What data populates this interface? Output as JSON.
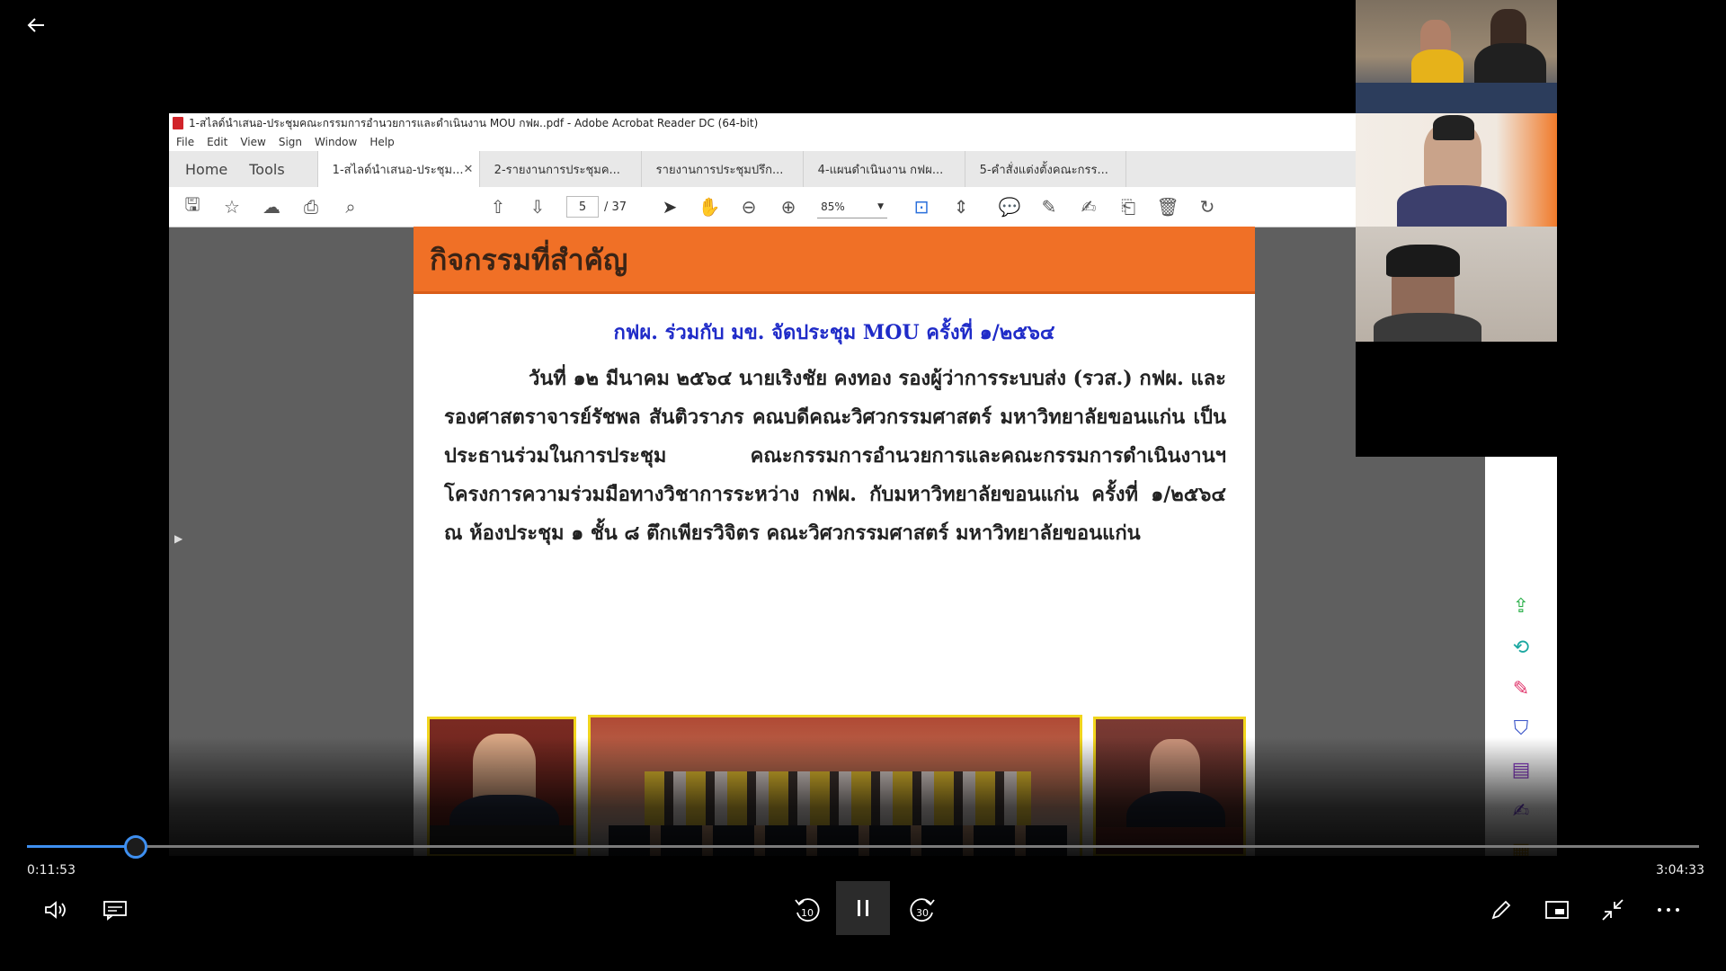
{
  "player": {
    "current_time": "0:11:53",
    "total_time": "3:04:33",
    "progress_fraction": 0.065,
    "icons": {
      "back": "back-arrow-icon",
      "volume": "volume-icon",
      "captions": "captions-icon",
      "rewind": "rewind-10-icon",
      "pause": "pause-icon",
      "forward": "forward-30-icon",
      "pen": "pen-icon",
      "miniplayer": "miniplayer-icon",
      "exit_fullscreen": "exit-fullscreen-icon",
      "more": "more-icon"
    },
    "rewind_label": "10",
    "forward_label": "30"
  },
  "acrobat": {
    "title": "1-สไลด์นำเสนอ-ประชุมคณะกรรมการอำนวยการและดำเนินงาน MOU กฟผ..pdf - Adobe Acrobat Reader DC (64-bit)",
    "menu": [
      "File",
      "Edit",
      "View",
      "Sign",
      "Window",
      "Help"
    ],
    "home_tab": "Home",
    "tools_tab": "Tools",
    "doc_tabs": [
      {
        "label": "1-สไลด์นำเสนอ-ประชุม...",
        "active": true
      },
      {
        "label": "2-รายงานการประชุมค...",
        "active": false
      },
      {
        "label": "รายงานการประชุมปรึก...",
        "active": false
      },
      {
        "label": "4-แผนดำเนินงาน กฟผ...",
        "active": false
      },
      {
        "label": "5-คำสั่งแต่งตั้งคณะกรร...",
        "active": false
      }
    ],
    "page_current": "5",
    "page_total": "/ 37",
    "zoom": "85%"
  },
  "slide": {
    "title": "กิจกรรมที่สำคัญ",
    "subtitle": "กฟผ. ร่วมกับ มข. จัดประชุม MOU ครั้งที่ ๑/๒๕๖๔",
    "body": "วันที่ ๑๒ มีนาคม ๒๕๖๔  นายเริงชัย คงทอง รองผู้ว่าการระบบส่ง (รวส.) กฟผ. และ รองศาสตราจารย์รัชพล สันติวราภร คณบดีคณะวิศวกรรมศาสตร์ มหาวิทยาลัยขอนแก่น เป็นประธานร่วมในการประชุม คณะกรรมการอำนวยการและคณะกรรมการดำเนินงานฯ โครงการความร่วมมือทางวิชาการระหว่าง กฟผ. กับมหาวิทยาลัยขอนแก่น ครั้งที่ ๑/๒๕๖๔ ณ ห้องประชุม ๑ ชั้น ๘ ตึกเพียรวิจิตร คณะวิศวกรรมศาสตร์ มหาวิทยาลัยขอนแก่น"
  },
  "colors": {
    "accent_orange": "#f07026",
    "subtitle_blue": "#1f2bc8",
    "progress_blue": "#3e8ff0",
    "photo_border": "#f1d51d"
  }
}
